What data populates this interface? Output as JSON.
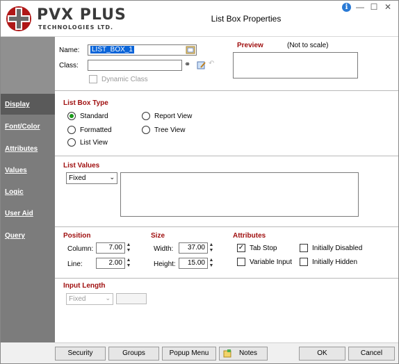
{
  "window": {
    "title": "List Box Properties"
  },
  "brand": {
    "name": "PVX PLUS",
    "sub": "TECHNOLOGIES LTD."
  },
  "sidebar": {
    "items": [
      {
        "label": "Display",
        "active": true
      },
      {
        "label": "Font/Color"
      },
      {
        "label": "Attributes"
      },
      {
        "label": "Values"
      },
      {
        "label": "Logic"
      },
      {
        "label": "User Aid"
      },
      {
        "label": "Query"
      }
    ]
  },
  "general": {
    "name_label": "Name:",
    "name_value": "LIST_BOX_1",
    "class_label": "Class:",
    "class_value": "",
    "dynamic_class_label": "Dynamic Class",
    "preview_label": "Preview",
    "preview_note": "(Not to scale)"
  },
  "listbox_type": {
    "title": "List Box Type",
    "options": [
      "Standard",
      "Formatted",
      "List View",
      "Report View",
      "Tree View"
    ],
    "selected": "Standard"
  },
  "list_values": {
    "title": "List Values",
    "mode": "Fixed"
  },
  "position": {
    "title": "Position",
    "column_label": "Column:",
    "column_value": "7.00",
    "line_label": "Line:",
    "line_value": "2.00"
  },
  "size": {
    "title": "Size",
    "width_label": "Width:",
    "width_value": "37.00",
    "height_label": "Height:",
    "height_value": "15.00"
  },
  "attributes": {
    "title": "Attributes",
    "tab_stop": "Tab Stop",
    "variable_input": "Variable Input",
    "initially_disabled": "Initially Disabled",
    "initially_hidden": "Initially Hidden"
  },
  "input_length": {
    "title": "Input Length",
    "mode": "Fixed",
    "value": ""
  },
  "footer": {
    "security": "Security",
    "groups": "Groups",
    "popup_menu": "Popup Menu",
    "notes": "Notes",
    "ok": "OK",
    "cancel": "Cancel"
  },
  "colors": {
    "accent": "#a01010",
    "selected_nav": "#5a5a5a",
    "sidebar": "#7c7c7c",
    "radio_on": "#1a9a1a"
  }
}
